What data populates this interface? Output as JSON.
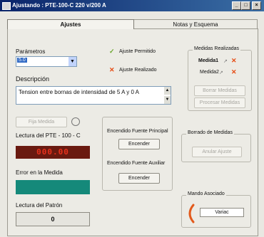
{
  "window": {
    "title": "Ajustando :  PTE-100-C  220 v/200 A",
    "minimize": "_",
    "maximize": "□",
    "close": "×"
  },
  "tabs": [
    {
      "label": "Ajustes",
      "active": true
    },
    {
      "label": "Notas y Esquema",
      "active": false
    }
  ],
  "parametros": {
    "label": "Parámetros",
    "value": "5.0"
  },
  "legend": {
    "ajuste_permitido": "Ajuste Permitido",
    "ajuste_realizado": "Ajuste Realizado"
  },
  "medidas_realizadas": {
    "title": "Medidas Realizadas",
    "medida1": "Medida1",
    "medida2": "Medida2",
    "borrar_label": "Borrar Medidas",
    "procesar_label": "Procesar Medidas"
  },
  "descripcion": {
    "label": "Descripción",
    "value": "Tension entre bornas de intensidad de 5 A y 0 A"
  },
  "fija_medida_label": "Fija Medida",
  "lectura_pte": {
    "label": "Lectura del PTE - 100 - C",
    "value": "000.00"
  },
  "encendido": {
    "principal_label": "Encendido Fuente Principal",
    "principal_button": "Encender",
    "auxiliar_label": "Encendido Fuente Auxiliar",
    "auxiliar_button": "Encender"
  },
  "borrado": {
    "title": "Borrado de Medidas",
    "button": "Anular Ajuste"
  },
  "error_medida_label": "Error en la Medida",
  "lectura_patron": {
    "label": "Lectura del Patrón",
    "value": "0"
  },
  "mando_asociado": {
    "title": "Mando Asociado",
    "value": "Variac"
  },
  "colors": {
    "title_start": "#0a246a",
    "title_end": "#3a6ea5",
    "display_bg": "#6a1a10",
    "display_fg": "#e8311b",
    "error_bar": "#15897a",
    "accent_x": "#e64b13",
    "accent_check": "#6aa52c"
  }
}
